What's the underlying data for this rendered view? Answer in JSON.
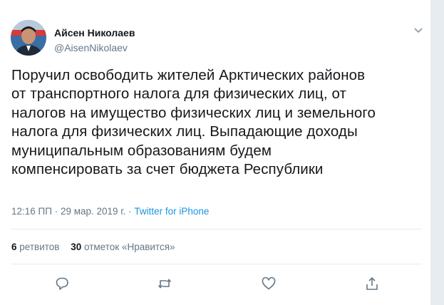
{
  "tweet": {
    "display_name": "Айсен Николаев",
    "handle": "@AisenNikolaev",
    "text": "Поручил освободить жителей Арктических районов\nот транспортного налога для физических лиц, от\nналогов на имущество физических лиц и земельного\nналога для физических лиц. Выпадающие доходы\nмуниципальным образованиям будем\nкомпенсировать за счет бюджета Республики",
    "time": "12:16 ПП",
    "separator": " · ",
    "date": "29 мар. 2019 г.",
    "separator2": " · ",
    "source": "Twitter for iPhone"
  },
  "stats": {
    "retweets_count": "6",
    "retweets_label": " ретвитов",
    "likes_count": "30",
    "likes_label": " отметок «Нравится»"
  },
  "icons": {
    "menu": "chevron-down-icon",
    "reply": "reply-icon",
    "retweet": "retweet-icon",
    "like": "heart-icon",
    "share": "share-icon"
  },
  "colors": {
    "text": "#14171a",
    "secondary": "#657786",
    "link": "#1b95e0",
    "border": "#e6ecf0"
  }
}
